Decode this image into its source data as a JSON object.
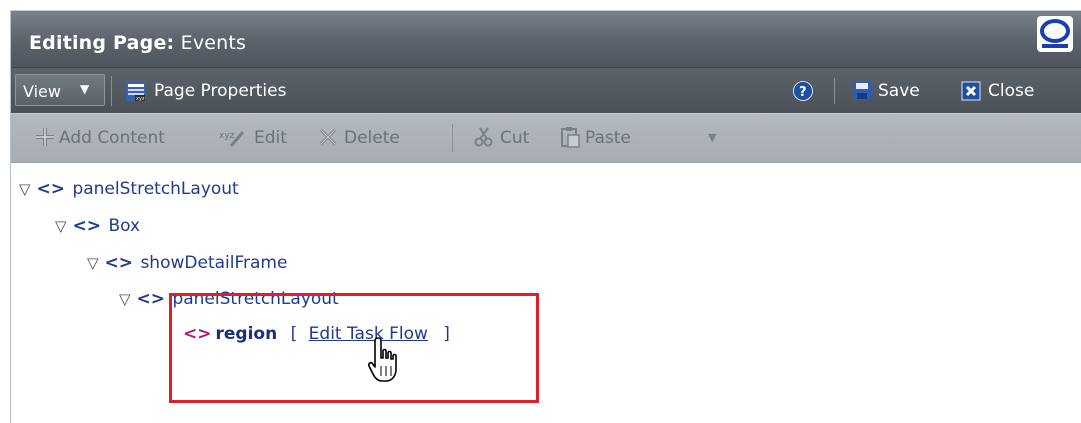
{
  "header": {
    "title_prefix": "Editing Page:",
    "page_name": "Events",
    "logo": "oracle-logo-icon"
  },
  "toolbar": {
    "view_label": "View",
    "page_properties_label": "Page Properties",
    "help_icon": "help-icon",
    "save_label": "Save",
    "close_label": "Close"
  },
  "edit_toolbar": {
    "add_content_label": "Add Content",
    "edit_label": "Edit",
    "delete_label": "Delete",
    "cut_label": "Cut",
    "paste_label": "Paste"
  },
  "tree": {
    "nodes": [
      {
        "label": "panelStretchLayout"
      },
      {
        "label": "Box"
      },
      {
        "label": "showDetailFrame"
      },
      {
        "label": "panelStretchLayout"
      }
    ],
    "region": {
      "label": "region",
      "open_bracket": "[",
      "link_label": "Edit Task Flow",
      "close_bracket": "]"
    }
  },
  "colors": {
    "title_bar": "#5b626b",
    "toolbar": "#4a5058",
    "edit_toolbar": "#a6acb2",
    "tree_text": "#1f3b8f",
    "region_icon": "#b0186c",
    "highlight_box": "#e21d2a"
  }
}
